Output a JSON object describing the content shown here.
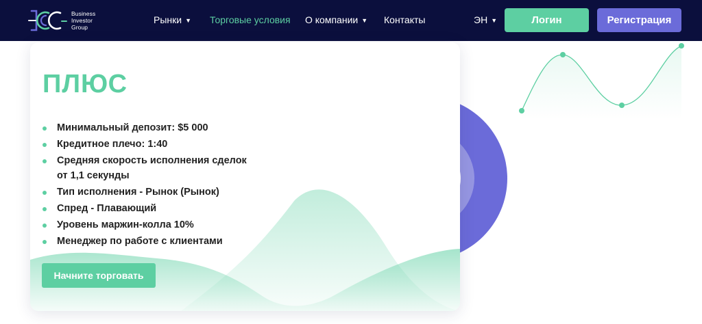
{
  "brand": {
    "name_lines": [
      "Business",
      "Investor",
      "Group"
    ],
    "accent_color": "#5dcfa2",
    "secondary_color": "#6b6bd9",
    "nav_bg": "#0b0f3d"
  },
  "nav": {
    "items": [
      {
        "label": "Рынки",
        "has_dropdown": true,
        "active": false
      },
      {
        "label": "Торговые условия",
        "has_dropdown": false,
        "active": true
      },
      {
        "label": "О компании",
        "has_dropdown": true,
        "active": false
      },
      {
        "label": "Контакты",
        "has_dropdown": false,
        "active": false
      }
    ],
    "language": "ЭН",
    "caret_glyph": "▼",
    "login_label": "Логин",
    "register_label": "Регистрация"
  },
  "account": {
    "title": "ПЛЮС",
    "features": [
      "Минимальный депозит: $5 000",
      "Кредитное плечо: 1:40",
      "Средняя скорость исполнения сделок от 1,1 секунды",
      "Тип исполнения - Рынок (Рынок)",
      "Спред - Плавающий",
      "Уровень маржин-колла 10%",
      "Менеджер по работе с клиентами"
    ],
    "cta_label": "Начните торговать"
  },
  "icons": {
    "logo": "big-logo-icon",
    "dropdown": "chevron-down-icon",
    "bullet": "bullet-dot-icon"
  }
}
